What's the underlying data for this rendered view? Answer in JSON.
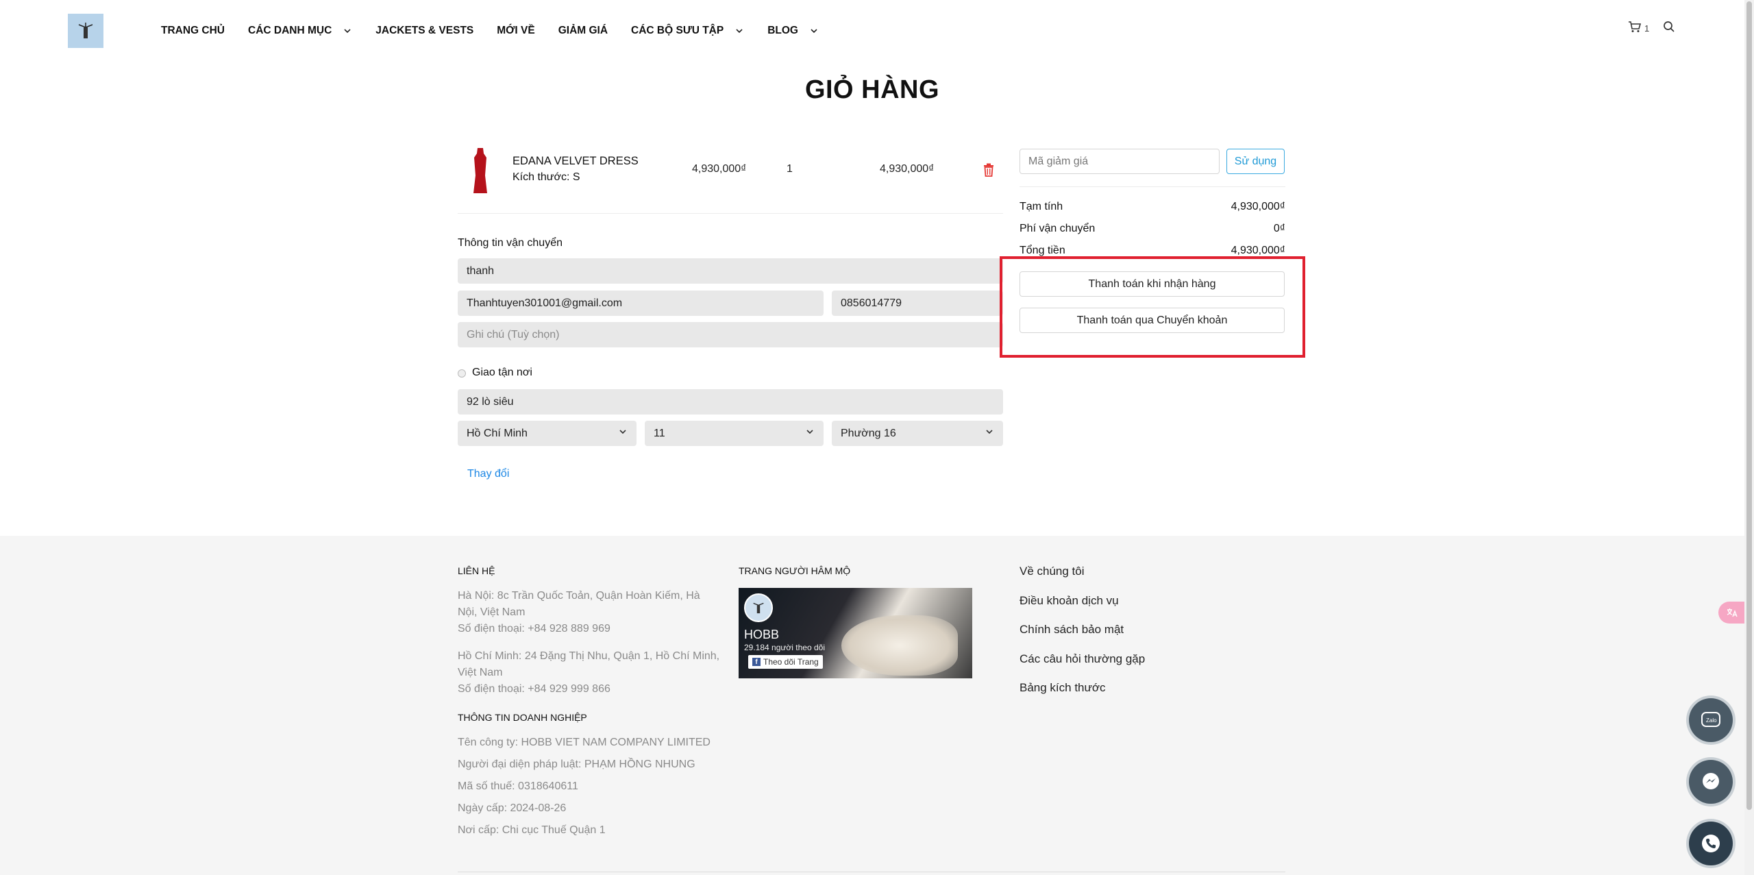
{
  "header": {
    "nav": [
      {
        "label": "TRANG CHỦ",
        "has_dropdown": false
      },
      {
        "label": "CÁC DANH MỤC",
        "has_dropdown": true
      },
      {
        "label": "JACKETS & VESTS",
        "has_dropdown": false
      },
      {
        "label": "MỚI VỀ",
        "has_dropdown": false
      },
      {
        "label": "GIẢM GIÁ",
        "has_dropdown": false
      },
      {
        "label": "CÁC BỘ SƯU TẬP",
        "has_dropdown": true
      },
      {
        "label": "BLOG",
        "has_dropdown": true
      }
    ],
    "cart_count": "1"
  },
  "page_title": "GIỎ HÀNG",
  "cart": {
    "item": {
      "name": "EDANA VELVET DRESS",
      "size": "Kích thước: S",
      "price": "4,930,000₫",
      "quantity": "1",
      "total": "4,930,000₫"
    }
  },
  "shipping": {
    "title": "Thông tin vận chuyển",
    "name_value": "thanh",
    "email_value": "Thanhtuyen301001@gmail.com",
    "phone_value": "0856014779",
    "note_placeholder": "Ghi chú (Tuỳ chọn)",
    "delivery_option": "Giao tận nơi",
    "address_value": "92 lò siêu",
    "city": "Hồ Chí Minh",
    "district": "11",
    "ward": "Phường 16",
    "change_link": "Thay đổi"
  },
  "summary": {
    "coupon_placeholder": "Mã giảm giá",
    "apply_label": "Sử dụng",
    "subtotal_label": "Tạm tính",
    "subtotal_value": "4,930,000₫",
    "shipping_label": "Phí vận chuyển",
    "shipping_value": "0₫",
    "total_label": "Tổng tiền",
    "total_value": "4,930,000₫",
    "pay_cod": "Thanh toán khi nhận hàng",
    "pay_transfer": "Thanh toán qua Chuyển khoản"
  },
  "footer": {
    "contact_heading": "LIÊN HỆ",
    "hanoi_address": "Hà Nội: 8c Trần Quốc Toản, Quận Hoàn Kiếm, Hà Nội, Việt Nam",
    "hanoi_phone": "Số điện thoại: +84 928 889 969",
    "hcm_address": "Hồ Chí Minh: 24 Đặng Thị Nhu, Quận 1, Hồ Chí Minh, Việt Nam",
    "hcm_phone": "Số điện thoại: +84 929 999 866",
    "company_heading": "THÔNG TIN DOANH NGHIỆP",
    "company_name": "Tên công ty: HOBB VIET NAM COMPANY LIMITED",
    "representative": "Người đại diện pháp luật: PHẠM HỒNG NHUNG",
    "tax_code": "Mã số thuế: 0318640611",
    "issue_date": "Ngày cấp: 2024-08-26",
    "issue_place": "Nơi cấp: Chi cục Thuế Quận 1",
    "fanpage_heading": "TRANG NGƯỜI HÂM MỘ",
    "fb_name": "HOBB",
    "fb_followers": "29.184 người theo dõi",
    "fb_follow_label": "Theo dõi Trang",
    "links": [
      "Về chúng tôi",
      "Điều khoản dịch vụ",
      "Chính sách bảo mật",
      "Các câu hỏi thường gặp",
      "Bảng kích thước"
    ]
  },
  "colors": {
    "accent": "#1f9ad6",
    "highlight": "#e0202f",
    "delete": "#e53935"
  }
}
